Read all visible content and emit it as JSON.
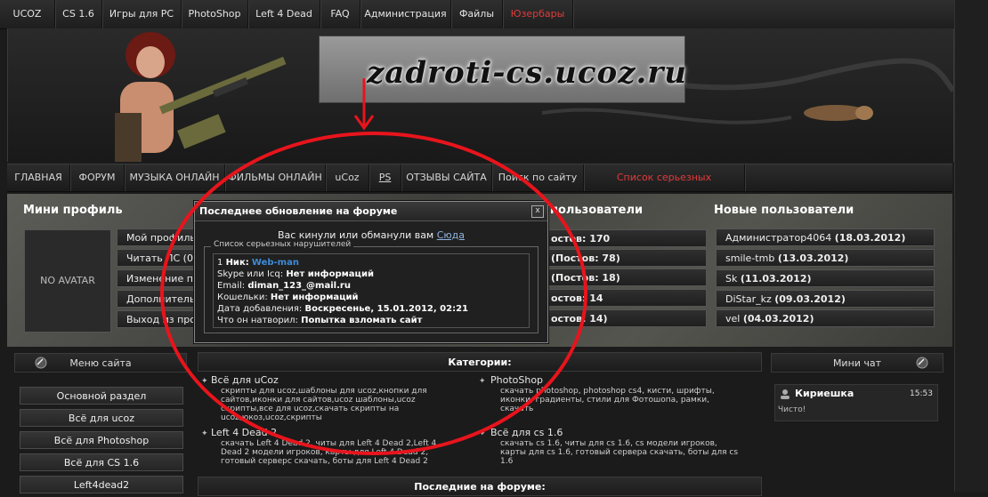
{
  "top_nav": [
    {
      "label": "UCOZ"
    },
    {
      "label": "CS 1.6"
    },
    {
      "label": "Игры для PC"
    },
    {
      "label": "PhotoShop"
    },
    {
      "label": "Left 4 Dead"
    },
    {
      "label": "FAQ"
    },
    {
      "label": "Администрация"
    },
    {
      "label": "Файлы"
    },
    {
      "label": "Юзербары"
    }
  ],
  "header": {
    "logo_text": "zadroti-cs.ucoz.ru"
  },
  "main_menu": [
    {
      "label": "ГЛАВНАЯ"
    },
    {
      "label": "ФОРУМ"
    },
    {
      "label": "МУЗЫКА ОНЛАЙН"
    },
    {
      "label": "ФИЛЬМЫ ОНЛАЙН"
    },
    {
      "label": "uCoz"
    },
    {
      "label": "PS"
    },
    {
      "label": "ОТЗЫВЫ САЙТА"
    },
    {
      "label": "Поиск по сайту"
    },
    {
      "label": "Список серьезных нарушителей"
    }
  ],
  "mini_profile": {
    "title": "Мини профиль",
    "avatar_text": "NO AVATAR",
    "buttons": [
      {
        "label": "Мой профиль"
      },
      {
        "label": "Читать ЛС (0"
      },
      {
        "label": "Изменение пр"
      },
      {
        "label": "Дополнительн"
      },
      {
        "label": "Выход из про"
      }
    ]
  },
  "top_users": {
    "title": "пользователи",
    "rows": [
      {
        "text": "остов: 170"
      },
      {
        "text": "(Постов: 78)"
      },
      {
        "text": "(Постов: 18)"
      },
      {
        "text": "остов: 14"
      },
      {
        "text": "остов: 14)"
      }
    ]
  },
  "new_users": {
    "title": "Новые пользователи",
    "rows": [
      {
        "name": "Администратор4064",
        "date": "(18.03.2012)"
      },
      {
        "name": "smile-tmb",
        "date": "(13.03.2012)"
      },
      {
        "name": "Sk",
        "date": "(11.03.2012)"
      },
      {
        "name": "DiStar_kz",
        "date": "(09.03.2012)"
      },
      {
        "name": "vel",
        "date": "(04.03.2012)"
      }
    ]
  },
  "site_menu": {
    "title": "Меню сайта",
    "items": [
      {
        "label": "Основной раздел"
      },
      {
        "label": "Всё для ucoz"
      },
      {
        "label": "Всё для Photoshop"
      },
      {
        "label": "Всё для CS 1.6"
      },
      {
        "label": "Left4dead2"
      }
    ]
  },
  "categories": {
    "title": "Категории:",
    "items": [
      {
        "title": "Всё для uCoz",
        "desc": [
          "скрипты для ucoz,шаблоны для ucoz,кнопки для",
          "сайтов,иконки для сайтов,ucoz шаблоны,ucoz",
          "скрипты,все для ucoz,скачать скрипты на",
          "ucoz,юкоз,ucoz,скрипты"
        ]
      },
      {
        "title": "PhotoShop",
        "desc": [
          "скачать photoshop, photoshop cs4, кисти, шрифты,",
          "иконки, градиенты, стили для Фотошопа, рамки,",
          "скачать"
        ]
      },
      {
        "title": "Left 4 Dead 2",
        "desc": [
          "скачать Left 4 Dead 2, читы для Left 4 Dead 2,Left 4",
          "Dead 2 модели игроков, карты для Left 4 Dead 2,",
          "готовый серверс скачать, боты для Left 4 Dead 2"
        ]
      },
      {
        "title": "Всё для cs 1.6",
        "desc": [
          "скачать cs 1.6, читы для cs 1.6, cs модели игроков,",
          "карты для cs 1.6, готовый сервера скачать, боты для cs",
          "1.6"
        ]
      }
    ]
  },
  "last_forum": {
    "title": "Последние на форуме:"
  },
  "mini_chat": {
    "title": "Мини чат",
    "message": {
      "author": "Кириешка",
      "time": "15:53",
      "text": "Чисто!"
    }
  },
  "popup": {
    "title": "Последнее обновление на форуме",
    "close": "x",
    "line_text": "Вас кинули или обманули вам",
    "line_link": "Сюда",
    "legend": "Список серьезных нарушителей",
    "entry": {
      "number": "1",
      "nick_label": "Ник:",
      "nick": "Web-man",
      "skype_label": "Skype или Icq:",
      "skype": "Нет информаций",
      "email_label": "Email:",
      "email": "diman_123_@mail.ru",
      "wallets_label": "Кошельки:",
      "wallets": "Нет информаций",
      "date_label": "Дата добавления:",
      "date": "Воскресенье, 15.01.2012, 02:21",
      "deed_label": "Что он натворил:",
      "deed": "Попытка взломать сайт"
    }
  },
  "colors": {
    "highlight_red": "#e03b3b",
    "link_blue": "#3d8bd8",
    "annotation_red": "#e8141c"
  }
}
